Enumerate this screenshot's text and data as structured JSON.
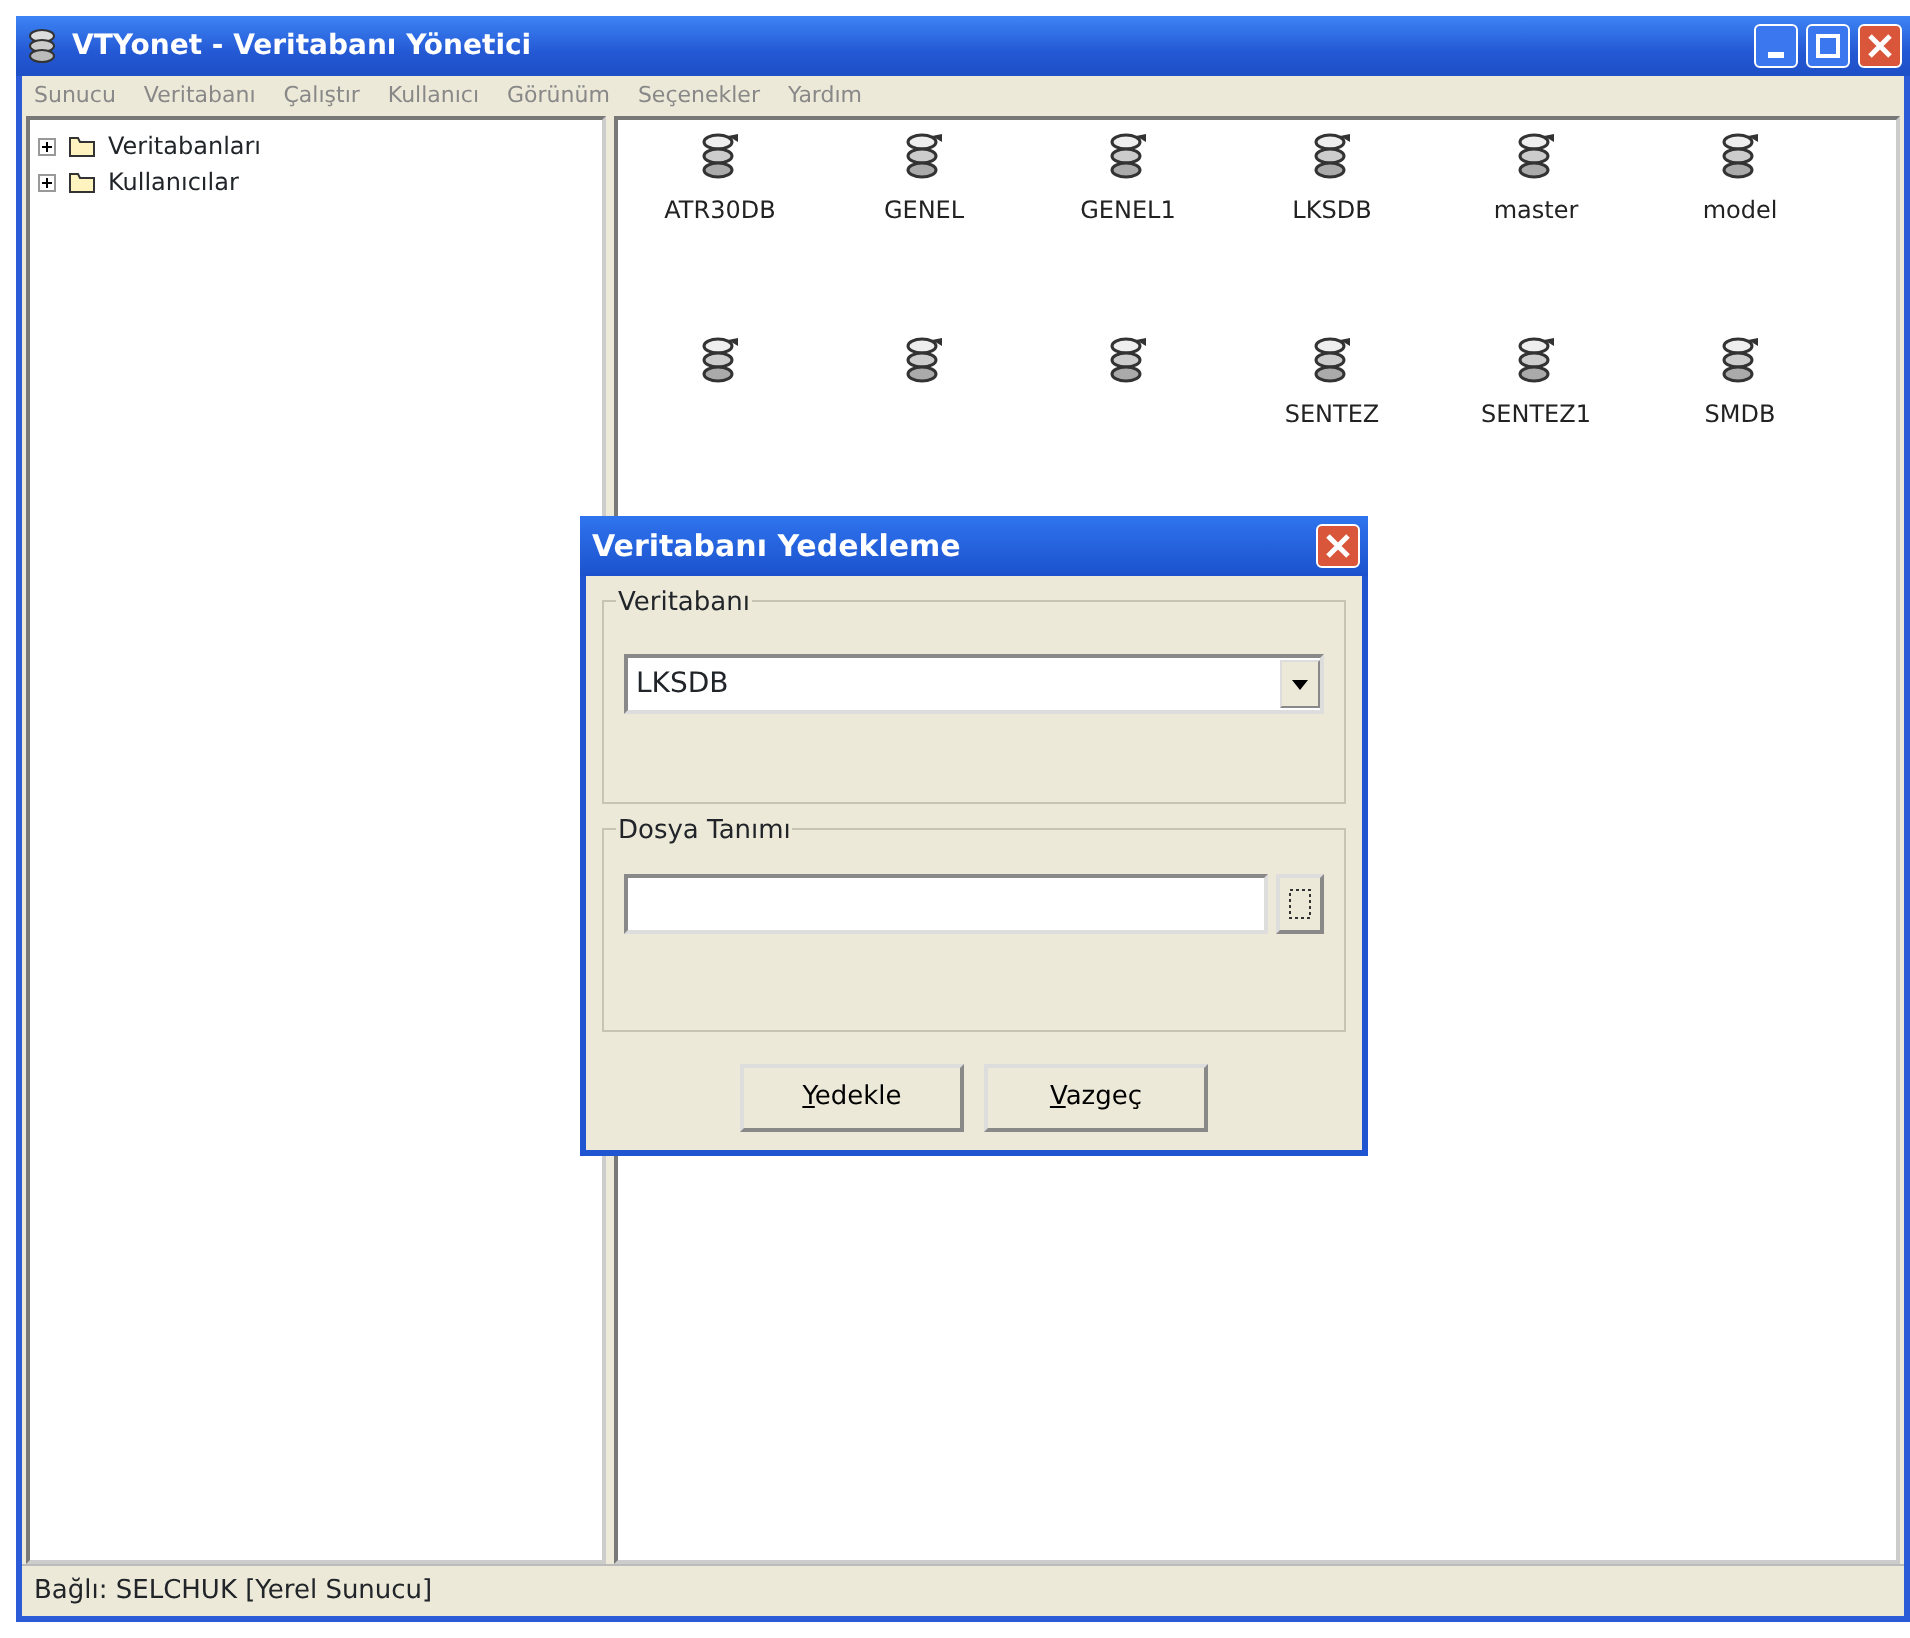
{
  "window": {
    "title": "VTYonet - Veritabanı Yönetici"
  },
  "menu": [
    "Sunucu",
    "Veritabanı",
    "Çalıştır",
    "Kullanıcı",
    "Görünüm",
    "Seçenekler",
    "Yardım"
  ],
  "tree": [
    {
      "label": "Veritabanları",
      "expanded": false
    },
    {
      "label": "Kullanıcılar",
      "expanded": false
    }
  ],
  "databases": [
    {
      "kind": "database",
      "label": "ATR30DB"
    },
    {
      "kind": "database",
      "label": "GENEL"
    },
    {
      "kind": "database",
      "label": "GENEL1"
    },
    {
      "kind": "database",
      "label": "LKSDB"
    },
    {
      "kind": "database",
      "label": "master"
    },
    {
      "kind": "database",
      "label": "model"
    },
    {
      "kind": "database"
    },
    {
      "kind": "database"
    },
    {
      "kind": "database"
    },
    {
      "kind": "database",
      "label": "SENTEZ"
    },
    {
      "kind": "database",
      "label": "SENTEZ1"
    },
    {
      "kind": "database",
      "label": "SMDB"
    }
  ],
  "dialog": {
    "title": "Veritabanı Yedekleme",
    "groups": [
      {
        "kind": "combo",
        "label": "Veritabanı",
        "value": "LKSDB"
      },
      {
        "kind": "file",
        "label": "Dosya Tanımı"
      }
    ],
    "buttons": [
      {
        "label": "Yedekle",
        "underline_first": true
      },
      {
        "label": "Vazgeç",
        "underline_first": true
      }
    ]
  },
  "status_bar": "Bağlı: SELCHUK [Yerel Sunucu]"
}
